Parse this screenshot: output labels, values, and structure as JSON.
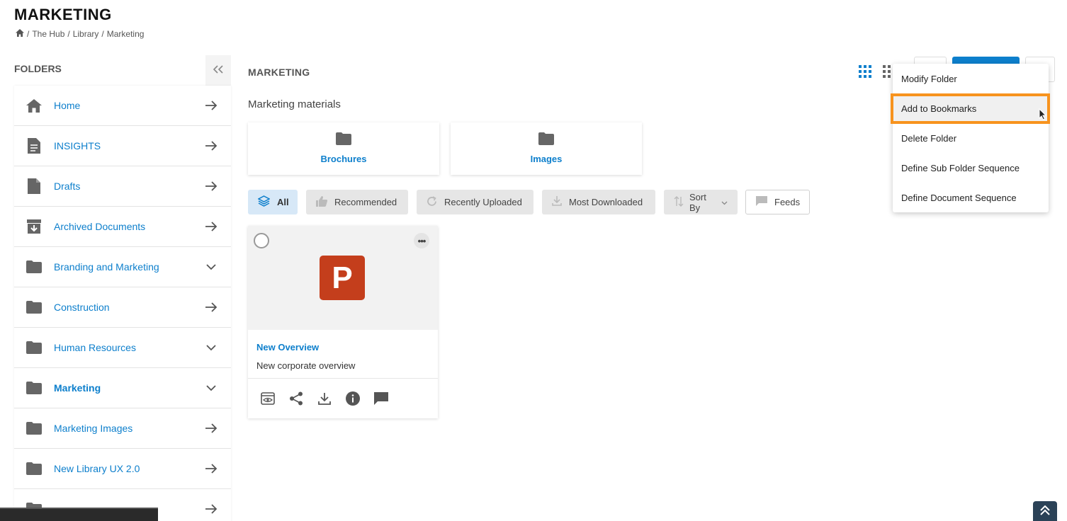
{
  "page": {
    "title": "MARKETING",
    "breadcrumb": [
      "The Hub",
      "Library",
      "Marketing"
    ],
    "breadcrumb_separator": "/"
  },
  "sidebar": {
    "title": "FOLDERS",
    "collapse_icon": "double-chevron-left-icon",
    "items": [
      {
        "label": "Home",
        "icon": "home-icon",
        "action": "arrow-right-icon"
      },
      {
        "label": "INSIGHTS",
        "icon": "document-icon",
        "action": "arrow-right-icon"
      },
      {
        "label": "Drafts",
        "icon": "file-icon",
        "action": "arrow-right-icon"
      },
      {
        "label": "Archived Documents",
        "icon": "archive-icon",
        "action": "arrow-right-icon"
      },
      {
        "label": "Branding and Marketing",
        "icon": "folder-icon",
        "action": "chevron-down-icon"
      },
      {
        "label": "Construction",
        "icon": "folder-icon",
        "action": "arrow-right-icon"
      },
      {
        "label": "Human Resources",
        "icon": "folder-icon",
        "action": "chevron-down-icon"
      },
      {
        "label": "Marketing",
        "icon": "folder-icon",
        "action": "chevron-down-icon",
        "active": true
      },
      {
        "label": "Marketing Images",
        "icon": "folder-icon",
        "action": "arrow-right-icon"
      },
      {
        "label": "New Library UX 2.0",
        "icon": "folder-icon",
        "action": "arrow-right-icon"
      },
      {
        "label": "",
        "icon": "folder-icon",
        "action": "arrow-right-icon"
      }
    ]
  },
  "main": {
    "title": "MARKETING",
    "section_title": "Marketing materials",
    "subfolders": [
      {
        "label": "Brochures"
      },
      {
        "label": "Images"
      }
    ],
    "filters": [
      {
        "label": "All",
        "icon": "layers-icon",
        "active": true
      },
      {
        "label": "Recommended",
        "icon": "thumbs-up-icon"
      },
      {
        "label": "Recently Uploaded",
        "icon": "refresh-icon"
      },
      {
        "label": "Most Downloaded",
        "icon": "download-icon"
      },
      {
        "label": "Sort By",
        "icon": "sort-icon"
      },
      {
        "label": "Feeds",
        "icon": "comment-icon"
      }
    ],
    "document": {
      "thumbnail_letter": "P",
      "title": "New Overview",
      "description": "New corporate overview",
      "more_label": "•••"
    }
  },
  "dropdown": {
    "items": [
      {
        "label": "Modify Folder"
      },
      {
        "label": "Add to Bookmarks",
        "highlighted": true
      },
      {
        "label": "Delete Folder"
      },
      {
        "label": "Define Sub Folder Sequence"
      },
      {
        "label": "Define Document Sequence"
      }
    ]
  },
  "colors": {
    "link": "#0d7fcc",
    "primary": "#0d7fcc",
    "highlight": "#f7931e",
    "ppt": "#c43e1c",
    "active_filter": "#d7e8f7"
  }
}
